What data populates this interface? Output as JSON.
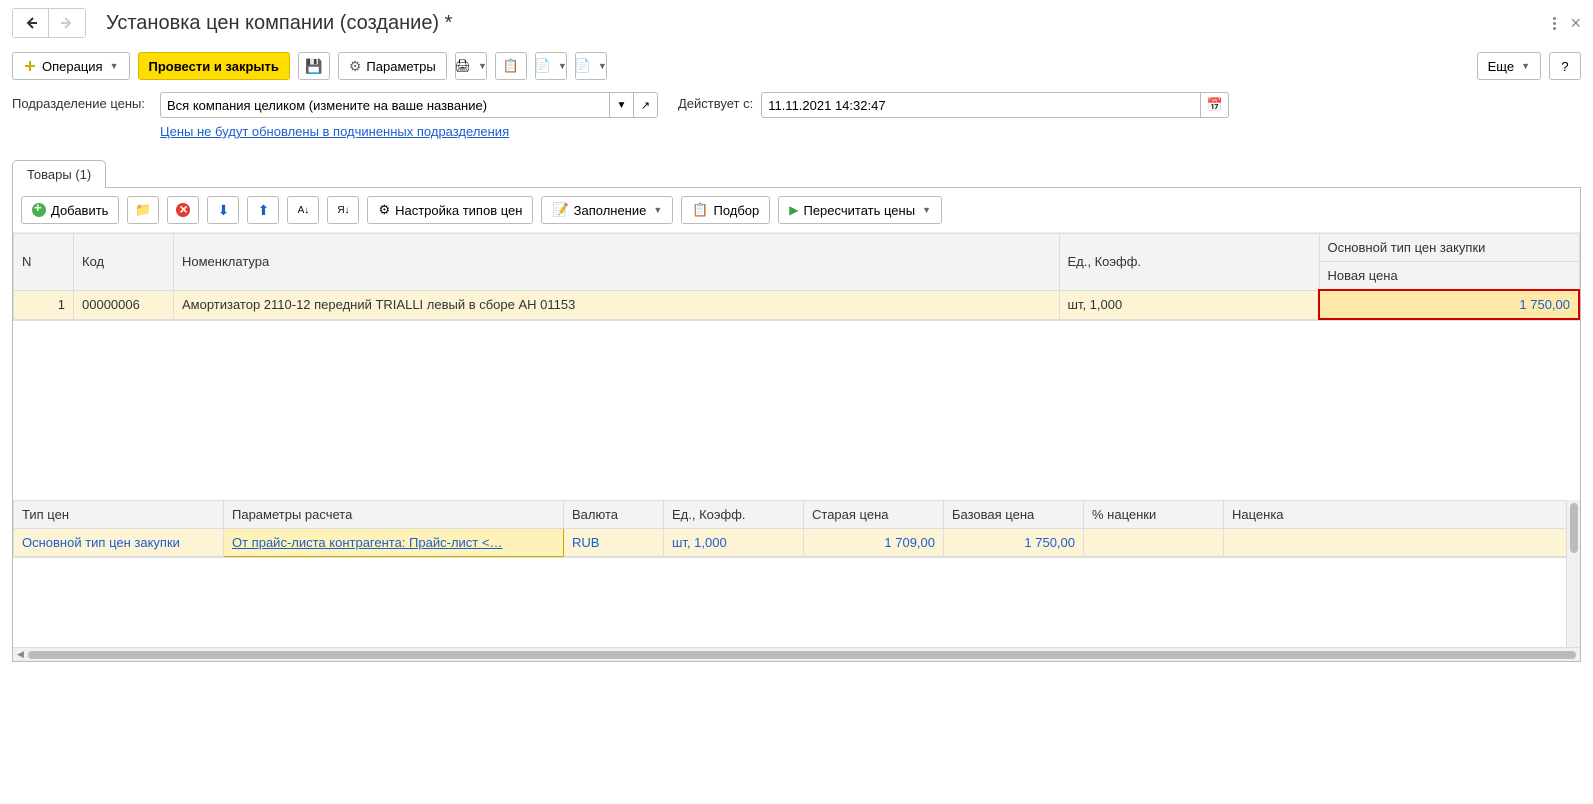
{
  "title": "Установка цен компании (создание) *",
  "toolbar": {
    "operation": "Операция",
    "post_close": "Провести и закрыть",
    "params": "Параметры",
    "more": "Еще",
    "help": "?"
  },
  "form": {
    "dept_label": "Подразделение цены:",
    "dept_value": "Вся компания целиком (измените на ваше название)",
    "dept_link": "Цены не будут обновлены в подчиненных подразделения",
    "date_label": "Действует с:",
    "date_value": "11.11.2021 14:32:47"
  },
  "tab": "Товары (1)",
  "panel_toolbar": {
    "add": "Добавить",
    "settings": "Настройка типов цен",
    "fill": "Заполнение",
    "pick": "Подбор",
    "recalc": "Пересчитать цены"
  },
  "grid": {
    "headers": {
      "n": "N",
      "code": "Код",
      "nomen": "Номенклатура",
      "unit": "Ед., Коэфф.",
      "pricetype": "Основной тип цен закупки",
      "newprice": "Новая цена"
    },
    "row": {
      "n": "1",
      "code": "00000006",
      "nomen": "Амортизатор 2110-12 передний TRIALLI левый в сборе АН 01153",
      "unit": "шт, 1,000",
      "newprice": "1 750,00"
    }
  },
  "grid2": {
    "headers": {
      "type": "Тип цен",
      "params": "Параметры расчета",
      "currency": "Валюта",
      "unit": "Ед., Коэфф.",
      "oldprice": "Старая цена",
      "baseprice": "Базовая цена",
      "markup_pct": "% наценки",
      "markup": "Наценка"
    },
    "row": {
      "type": "Основной тип цен закупки",
      "params": "От прайс-листа контрагента: Прайс-лист <…",
      "currency": "RUB",
      "unit": "шт, 1,000",
      "oldprice": "1 709,00",
      "baseprice": "1 750,00",
      "markup_pct": "",
      "markup": ""
    }
  }
}
